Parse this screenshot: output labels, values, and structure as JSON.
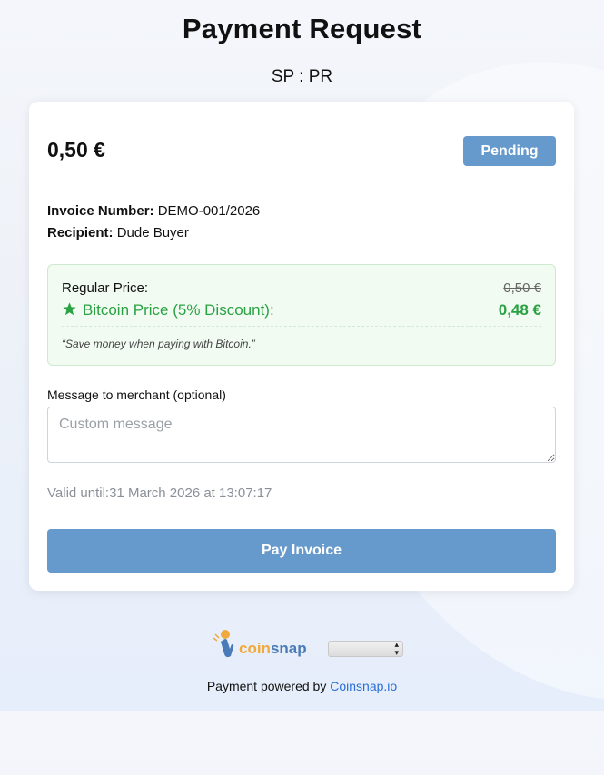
{
  "page": {
    "title": "Payment Request",
    "store": "SP : PR"
  },
  "invoice": {
    "amount": "0,50 €",
    "status": "Pending",
    "number_label": "Invoice Number:",
    "number": "DEMO-001/2026",
    "recipient_label": "Recipient:",
    "recipient": "Dude Buyer"
  },
  "discount": {
    "regular_label": "Regular Price:",
    "regular_price": "0,50 €",
    "bitcoin_label": "Bitcoin Price (5% Discount):",
    "bitcoin_price": "0,48 €",
    "quote": "“Save money when paying with Bitcoin.”"
  },
  "message": {
    "label": "Message to merchant (optional)",
    "placeholder": "Custom message",
    "value": ""
  },
  "valid_until": "Valid until:31 March 2026 at 13:07:17",
  "pay_button": "Pay Invoice",
  "footer": {
    "logo_coin": "coin",
    "logo_snap": "snap",
    "powered_prefix": "Payment powered by ",
    "powered_link": "Coinsnap.io",
    "language_value": ""
  },
  "colors": {
    "accent": "#6699cc",
    "discount_green": "#2aa243",
    "discount_bg": "#f1fbf1"
  },
  "icons": {
    "discount": "star-icon",
    "logo": "coinsnap-logo-icon"
  }
}
